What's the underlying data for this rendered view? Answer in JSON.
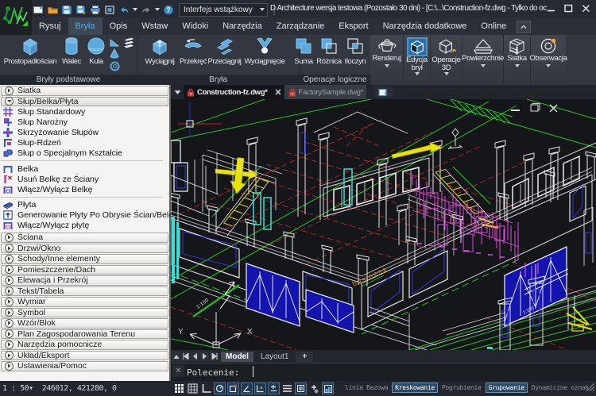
{
  "window": {
    "title": "D Architecture wersja testowa (Pozostało 30 dni) - [C:\\...\\Construction-fz.dwg - Tylko do oc",
    "controls": {
      "minimize": "minimize",
      "maximize": "maximize",
      "close": "close"
    },
    "workspace_dropdown": "Interfejs wstążkowy"
  },
  "ribbon_tabs": [
    {
      "label": "Rysuj"
    },
    {
      "label": "Bryła",
      "active": true
    },
    {
      "label": "Opis"
    },
    {
      "label": "Wstaw"
    },
    {
      "label": "Widoki"
    },
    {
      "label": "Narzędzia"
    },
    {
      "label": "Zarządzanie"
    },
    {
      "label": "Eksport"
    },
    {
      "label": "Narzędzia dodatkowe"
    },
    {
      "label": "Online"
    }
  ],
  "ribbon": {
    "groups": [
      {
        "label": "Bryły podstawowe",
        "buttons": [
          {
            "label": "Prostopadłościan"
          },
          {
            "label": "Walec"
          },
          {
            "label": "Kula"
          }
        ]
      },
      {
        "label": "Bryła",
        "buttons": [
          {
            "label": "Wyciągnij"
          },
          {
            "label": "Przekręć"
          },
          {
            "label": "Przeciągnij"
          },
          {
            "label": "Wyciągnięcie"
          }
        ]
      },
      {
        "label": "Operacje logiczne",
        "buttons": [
          {
            "label": "Suma"
          },
          {
            "label": "Różnica"
          },
          {
            "label": "Iloczyn"
          }
        ]
      }
    ],
    "split_buttons": [
      {
        "label": "Renderuj"
      },
      {
        "label": "Edycja brył"
      },
      {
        "label": "Operacje 3D"
      },
      {
        "label": "Powierzchnie"
      },
      {
        "label": "Siatka"
      },
      {
        "label": "Obserwacja"
      }
    ]
  },
  "palette": {
    "top_sections": [
      {
        "label": "Siatka",
        "state": "collapsed"
      },
      {
        "label": "Słup/Belka/Płyta",
        "state": "expanded"
      }
    ],
    "items": [
      {
        "label": "Słup Standardowy"
      },
      {
        "label": "Słup Narożny"
      },
      {
        "label": "Skrzyżowanie Słupów"
      },
      {
        "label": "Słup-Rdzeń"
      },
      {
        "label": "Słup o Specjalnym Kształcie"
      },
      {
        "label": "Belka"
      },
      {
        "label": "Usuń Belkę ze Ściany"
      },
      {
        "label": "Włącz/Wyłącz Belkę"
      },
      {
        "label": "Płyta"
      },
      {
        "label": "Generowanie Płyty Po Obrysie Ścian/Belek"
      },
      {
        "label": "Włącz/Wyłącz płytę"
      }
    ],
    "collapsed_sections": [
      {
        "label": "Ściana"
      },
      {
        "label": "Drzwi/Okno"
      },
      {
        "label": "Schody/Inne elementy"
      },
      {
        "label": "Pomieszczenie/Dach"
      },
      {
        "label": "Elewacja i Przekrój"
      },
      {
        "label": "Tekst/Tabela"
      },
      {
        "label": "Wymiar"
      },
      {
        "label": "Symbol"
      },
      {
        "label": "Wzór/Blok"
      },
      {
        "label": "Plan Zagospodarowania Terenu"
      },
      {
        "label": "Narzędzia pomocnicze"
      },
      {
        "label": "Układ/Eksport"
      },
      {
        "label": "Ustawienia/Pomoc"
      }
    ]
  },
  "doc_tabs": [
    {
      "label": "Construction-fz.dwg*",
      "active": true,
      "locked": true,
      "closable": true
    },
    {
      "label": "FactorySample.dwg*",
      "active": false,
      "locked": true
    }
  ],
  "canvas": {
    "ucs": {
      "x_label": "X",
      "y_label": "Y"
    },
    "annotation": "business",
    "scale_label_1": "1:100",
    "scale_label_2": "1:100"
  },
  "layout_tabs": [
    {
      "label": "Model",
      "active": true
    },
    {
      "label": "Layout1"
    },
    {
      "label": "+"
    }
  ],
  "command_line": {
    "prompt": "Polecenie:"
  },
  "status_bar": {
    "scale": "1 : 50",
    "coordinates": "246012, 421280, 0",
    "toggles": [
      {
        "label": "linia Bazowa",
        "on": false
      },
      {
        "label": "Kreskowanie",
        "on": true
      },
      {
        "label": "Pogrubienie",
        "on": false
      },
      {
        "label": "Grupowanie",
        "on": true
      },
      {
        "label": "Dynamiczne oznak",
        "on": false
      }
    ]
  },
  "colors": {
    "accent_blue": "#54aae9",
    "icon_blue": "#5aa9de",
    "lock_red": "#d03b37",
    "canvas_green": "#25c425",
    "canvas_red": "#b42525",
    "canvas_yellow": "#e8e400",
    "canvas_cyan": "#35ded6",
    "canvas_magenta": "#e04ae0"
  }
}
